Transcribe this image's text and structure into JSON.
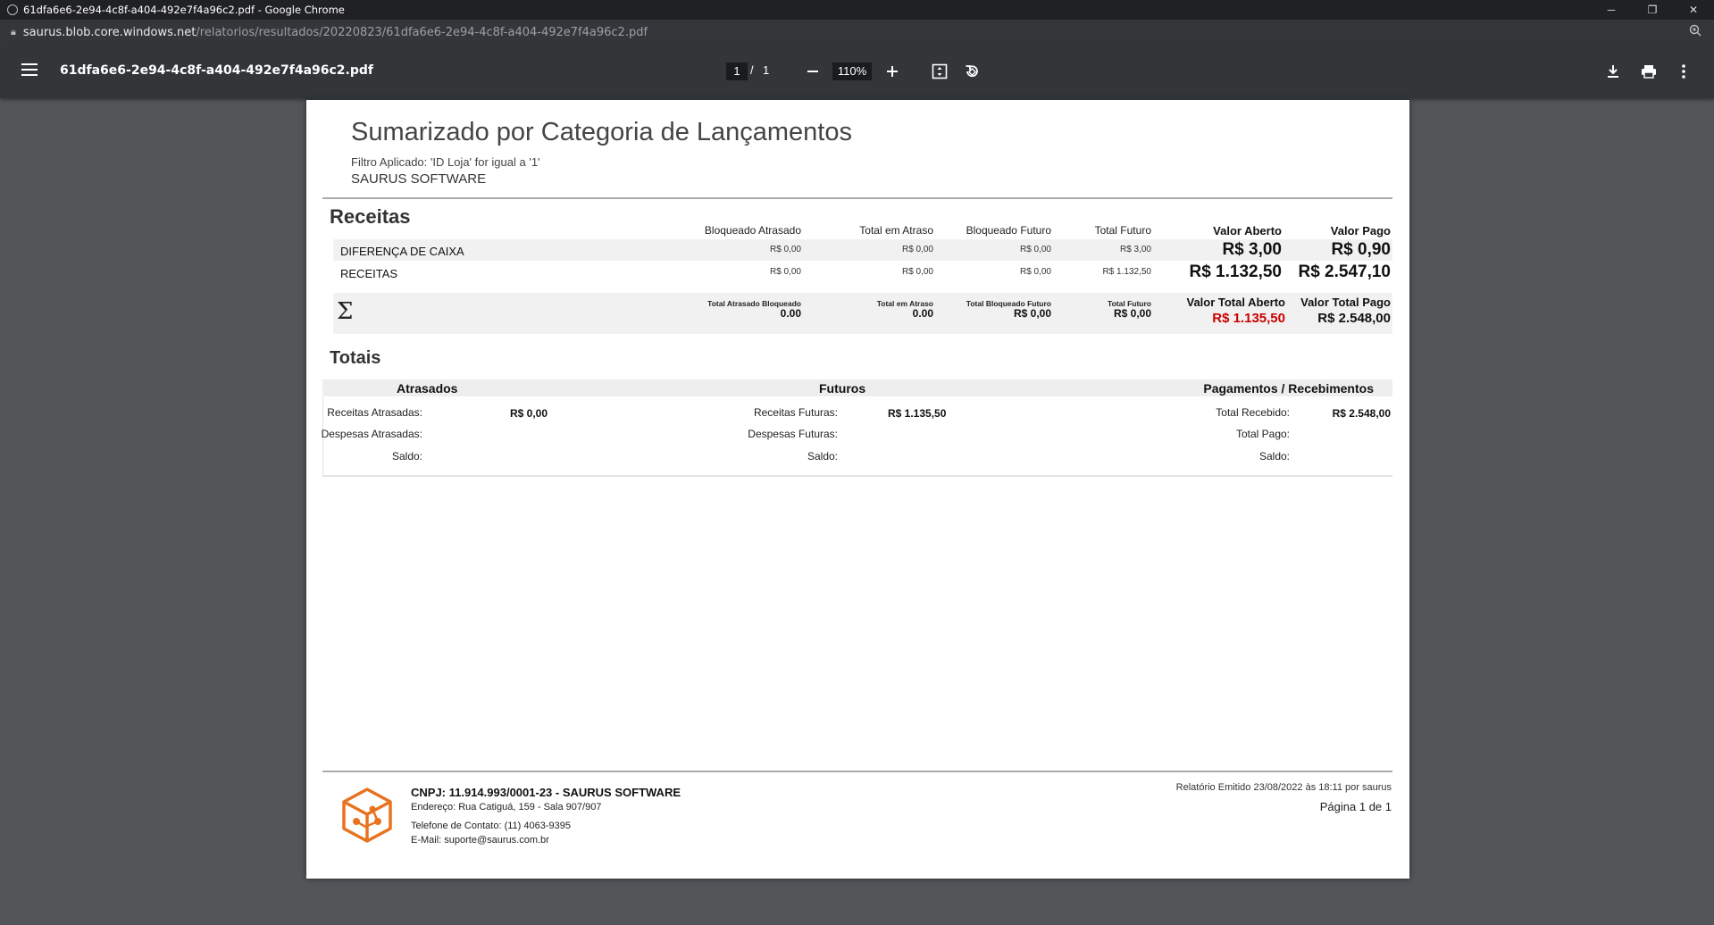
{
  "window": {
    "title": "61dfa6e6-2e94-4c8f-a404-492e7f4a96c2.pdf - Google Chrome",
    "minimize": "─",
    "restore": "❐",
    "close": "✕"
  },
  "address": {
    "host": "saurus.blob.core.windows.net",
    "path": "/relatorios/resultados/20220823/61dfa6e6-2e94-4c8f-a404-492e7f4a96c2.pdf"
  },
  "viewer": {
    "filename": "61dfa6e6-2e94-4c8f-a404-492e7f4a96c2.pdf",
    "page_current": "1",
    "page_sep": "/",
    "page_total": "1",
    "zoom": "110%",
    "zoom_out": "−",
    "zoom_in": "+",
    "icons": [
      "menu-icon",
      "zoom-out-icon",
      "zoom-in-icon",
      "fit-page-icon",
      "rotate-icon",
      "download-icon",
      "print-icon",
      "more-icon"
    ]
  },
  "report": {
    "title": "Sumarizado por Categoria de Lançamentos",
    "filter": "Filtro Aplicado: 'ID Loja' for igual a '1'",
    "company": "SAURUS SOFTWARE",
    "receitas": {
      "section_title": "Receitas",
      "headers": {
        "bloqueado_atrasado": "Bloqueado Atrasado",
        "total_em_atraso": "Total em Atraso",
        "bloqueado_futuro": "Bloqueado Futuro",
        "total_futuro": "Total Futuro",
        "valor_aberto": "Valor Aberto",
        "valor_pago": "Valor Pago"
      },
      "rows": [
        {
          "name": "DIFERENÇA DE CAIXA",
          "bloqueado_atrasado": "R$ 0,00",
          "total_em_atraso": "R$ 0,00",
          "bloqueado_futuro": "R$ 0,00",
          "total_futuro": "R$ 3,00",
          "valor_aberto": "R$ 3,00",
          "valor_pago": "R$ 0,90"
        },
        {
          "name": "RECEITAS",
          "bloqueado_atrasado": "R$ 0,00",
          "total_em_atraso": "R$ 0,00",
          "bloqueado_futuro": "R$ 0,00",
          "total_futuro": "R$ 1.132,50",
          "valor_aberto": "R$ 1.132,50",
          "valor_pago": "R$ 2.547,10"
        }
      ],
      "summary": {
        "symbol": "Σ",
        "total_atrasado_bloqueado_label": "Total Atrasado Bloqueado",
        "total_atrasado_bloqueado": "0.00",
        "total_em_atraso_label": "Total em Atraso",
        "total_em_atraso": "0.00",
        "total_bloqueado_futuro_label": "Total Bloqueado Futuro",
        "total_bloqueado_futuro": "R$ 0,00",
        "total_futuro_label": "Total Futuro",
        "total_futuro": "R$ 0,00",
        "valor_total_aberto_label": "Valor Total Aberto",
        "valor_total_aberto": "R$ 1.135,50",
        "valor_total_pago_label": "Valor Total Pago",
        "valor_total_pago": "R$ 2.548,00",
        "highlight_color": "#cc0000"
      }
    },
    "totais": {
      "section_title": "Totais",
      "atrasados": {
        "header": "Atrasados",
        "receitas_label": "Receitas Atrasadas:",
        "receitas_value": "R$ 0,00",
        "despesas_label": "Despesas Atrasadas:",
        "saldo_label": "Saldo:"
      },
      "futuros": {
        "header": "Futuros",
        "receitas_label": "Receitas Futuras:",
        "receitas_value": "R$ 1.135,50",
        "despesas_label": "Despesas Futuras:",
        "saldo_label": "Saldo:"
      },
      "pagamentos": {
        "header": "Pagamentos / Recebimentos",
        "recebido_label": "Total Recebido:",
        "recebido_value": "R$ 2.548,00",
        "pago_label": "Total Pago:",
        "saldo_label": "Saldo:"
      }
    },
    "footer": {
      "cnpj": "CNPJ: 11.914.993/0001-23 - SAURUS SOFTWARE",
      "endereco": "Endereço: Rua Catiguá, 159 - Sala 907/907",
      "telefone": "Telefone de Contato: (11) 4063-9395",
      "email": "E-Mail: suporte@saurus.com.br",
      "emitido": "Relatório Emitido 23/08/2022  às  18:11 por saurus",
      "pagina": "Página 1 de 1",
      "logo_color": "#e8731f"
    }
  }
}
